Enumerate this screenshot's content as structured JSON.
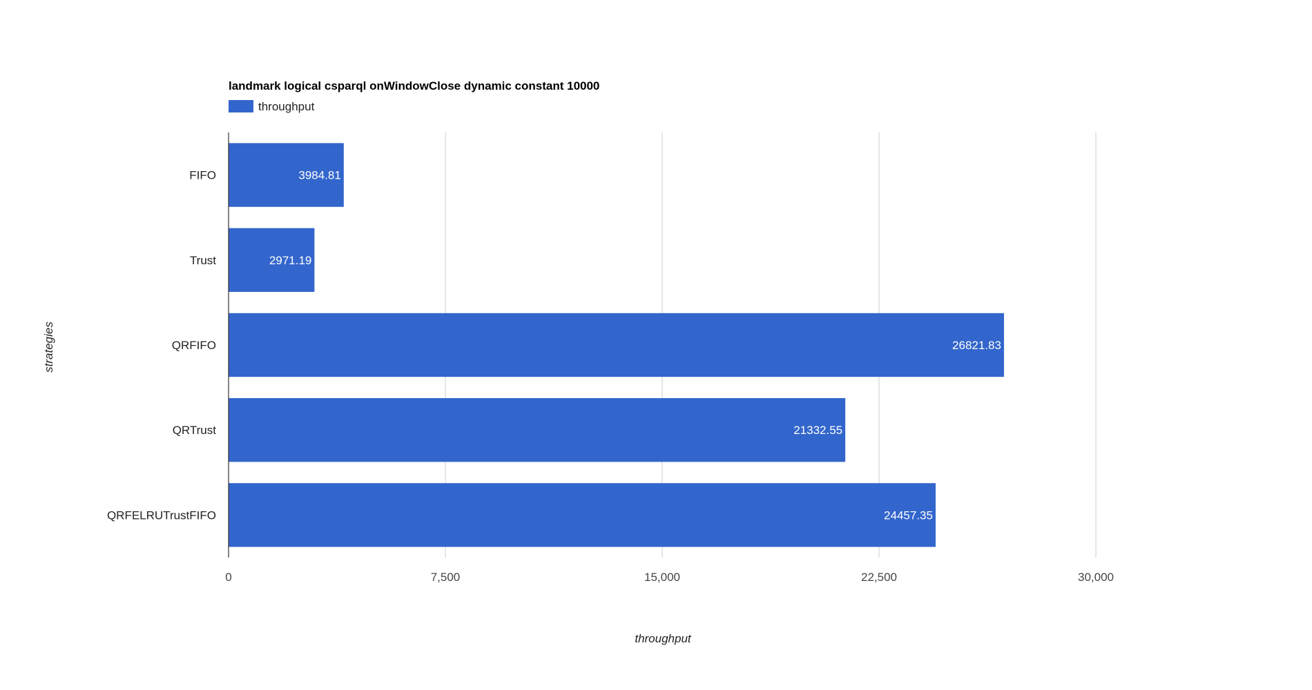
{
  "chart_data": {
    "type": "bar",
    "orientation": "horizontal",
    "title": "landmark logical csparql onWindowClose dynamic constant 10000",
    "xlabel": "throughput",
    "ylabel": "strategies",
    "categories": [
      "FIFO",
      "Trust",
      "QRFIFO",
      "QRTrust",
      "QRFELRUTrustFIFO"
    ],
    "series": [
      {
        "name": "throughput",
        "values": [
          3984.81,
          2971.19,
          26821.83,
          21332.55,
          24457.35
        ],
        "data_labels": [
          "3984.81",
          "2971.19",
          "26821.83",
          "21332.55",
          "24457.35"
        ],
        "color": "#3366cc"
      }
    ],
    "xlim": [
      0,
      30000
    ],
    "xticks": [
      0,
      7500,
      15000,
      22500,
      30000
    ],
    "xtick_labels": [
      "0",
      "7,500",
      "15,000",
      "22,500",
      "30,000"
    ],
    "grid": true,
    "legend_position": "top-left"
  }
}
